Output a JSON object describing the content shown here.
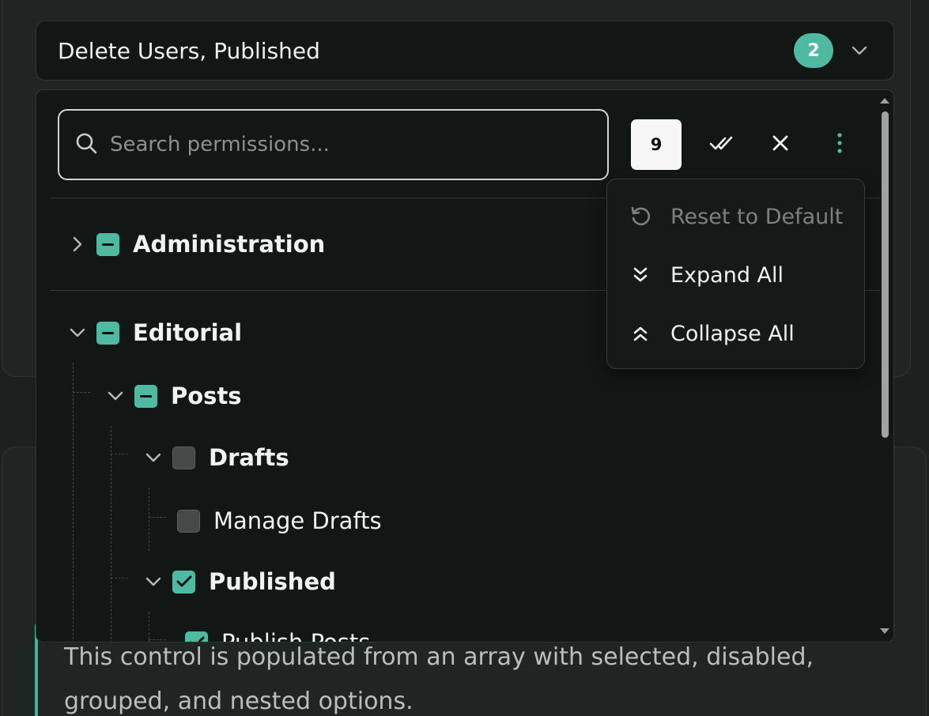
{
  "trigger": {
    "value_text": "Delete Users, Published",
    "selected_badge": "2"
  },
  "search": {
    "placeholder": "Search permissions..."
  },
  "toolbar": {
    "selected_count": "9"
  },
  "menu": {
    "items": [
      {
        "label": "Reset to Default",
        "icon": "reset-icon",
        "disabled": true
      },
      {
        "label": "Expand All",
        "icon": "chevrons-down-icon"
      },
      {
        "label": "Collapse All",
        "icon": "chevrons-up-icon"
      }
    ]
  },
  "tree": {
    "administration": {
      "label": "Administration",
      "state": "partial",
      "expanded": false
    },
    "editorial": {
      "label": "Editorial",
      "state": "partial",
      "expanded": true
    },
    "posts": {
      "label": "Posts",
      "state": "partial",
      "expanded": true
    },
    "drafts": {
      "label": "Drafts",
      "state": "unchecked",
      "expanded": true
    },
    "manage_drafts": {
      "label": "Manage Drafts",
      "state": "unchecked"
    },
    "published": {
      "label": "Published",
      "state": "checked",
      "expanded": true
    },
    "publish_posts": {
      "label": "Publish Posts",
      "state": "checked"
    }
  },
  "note": {
    "text": "This control is populated from an array with selected, disabled, grouped, and nested options."
  },
  "colors": {
    "accent": "#4fb9a1",
    "panel": "#121614",
    "background": "#1c2120"
  }
}
